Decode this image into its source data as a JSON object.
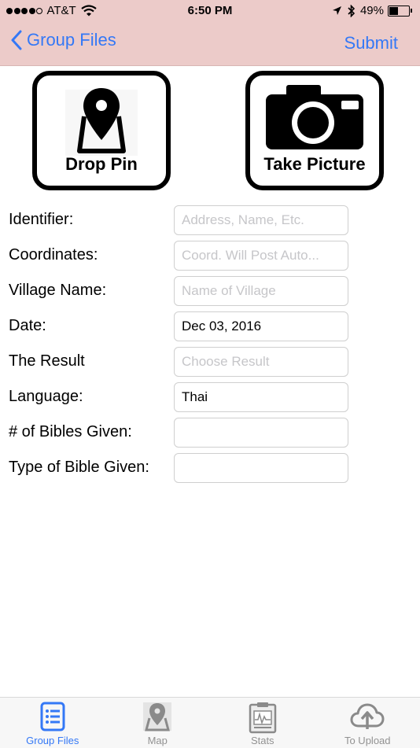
{
  "status_bar": {
    "carrier": "AT&T",
    "time": "6:50 PM",
    "battery_percent": "49%",
    "battery_level": 0.49
  },
  "nav": {
    "back_label": "Group Files",
    "submit_label": "Submit"
  },
  "actions": {
    "drop_pin_label": "Drop Pin",
    "take_picture_label": "Take Picture"
  },
  "form": {
    "fields": [
      {
        "label": "Identifier:",
        "value": "",
        "placeholder": "Address, Name, Etc."
      },
      {
        "label": "Coordinates:",
        "value": "",
        "placeholder": "Coord. Will Post Auto..."
      },
      {
        "label": "Village Name:",
        "value": "",
        "placeholder": "Name of Village"
      },
      {
        "label": "Date:",
        "value": "Dec 03, 2016",
        "placeholder": ""
      },
      {
        "label": "The Result",
        "value": "",
        "placeholder": "Choose Result"
      },
      {
        "label": "Language:",
        "value": "Thai",
        "placeholder": ""
      },
      {
        "label": "# of Bibles Given:",
        "value": "",
        "placeholder": ""
      },
      {
        "label": "Type of Bible Given:",
        "value": "",
        "placeholder": ""
      }
    ]
  },
  "tabs": [
    {
      "label": "Group Files",
      "icon": "document-list-icon",
      "active": true
    },
    {
      "label": "Map",
      "icon": "map-pin-icon",
      "active": false
    },
    {
      "label": "Stats",
      "icon": "chart-clipboard-icon",
      "active": false
    },
    {
      "label": "To Upload",
      "icon": "cloud-upload-icon",
      "active": false
    }
  ],
  "colors": {
    "nav_background": "#eccbc9",
    "accent": "#3478f6",
    "tab_inactive": "#929292"
  }
}
